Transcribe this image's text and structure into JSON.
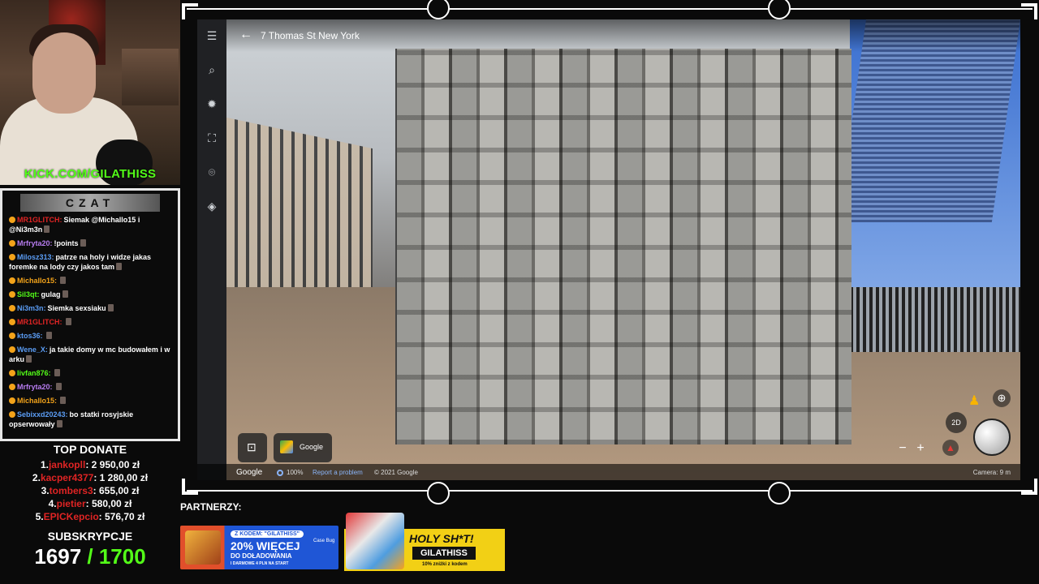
{
  "stream": {
    "kick_url": "KICK.COM/GILATHISS"
  },
  "chat": {
    "title": "CZAT",
    "messages": [
      {
        "user": "MR1GLITCH:",
        "user_color": "#e02424",
        "text": "Siemak @Michallo15 i @Ni3m3n"
      },
      {
        "user": "Mrfryta20:",
        "user_color": "#b77cf0",
        "text": "!points"
      },
      {
        "user": "Milosz313:",
        "user_color": "#5b9df5",
        "text": "patrze na holy i widze jakas foremke na lody czy jakos tam"
      },
      {
        "user": "Michallo15:",
        "user_color": "#f3a31a",
        "text": ""
      },
      {
        "user": "Sil3qt:",
        "user_color": "#53fc18",
        "text": "gulag"
      },
      {
        "user": "Ni3m3n:",
        "user_color": "#5b9df5",
        "text": "Siemka sexsiaku"
      },
      {
        "user": "MR1GLITCH:",
        "user_color": "#e02424",
        "text": ""
      },
      {
        "user": "ktos36:",
        "user_color": "#5b9df5",
        "text": ""
      },
      {
        "user": "Wene_X:",
        "user_color": "#5b9df5",
        "text": "ja takie domy w mc budowałem i w arku"
      },
      {
        "user": "livfan876:",
        "user_color": "#53fc18",
        "text": ""
      },
      {
        "user": "Mrfryta20:",
        "user_color": "#b77cf0",
        "text": ""
      },
      {
        "user": "Michallo15:",
        "user_color": "#f3a31a",
        "text": ""
      },
      {
        "user": "Sebixxd20243:",
        "user_color": "#5b9df5",
        "text": "bo statki rosyjskie opserwowały"
      }
    ]
  },
  "top_donate": {
    "title": "TOP DONATE",
    "entries": [
      {
        "rank": "1.",
        "name": "jankopll",
        "amount": "2 950,00 zł"
      },
      {
        "rank": "2.",
        "name": "kacper4377",
        "amount": "1 280,00 zł"
      },
      {
        "rank": "3.",
        "name": "tombers3",
        "amount": "655,00 zł"
      },
      {
        "rank": "4.",
        "name": "pietier",
        "amount": "580,00 zł"
      },
      {
        "rank": "5.",
        "name": "EPICKepcio",
        "amount": "576,70 zł"
      }
    ]
  },
  "subs": {
    "title": "SUBSKRYPCJE",
    "current": "1697",
    "goal": "/ 1700"
  },
  "maps": {
    "address": "7 Thomas St New York",
    "google_chip": "Google",
    "footer_google": "Google",
    "zoom": "100%",
    "report": "Report a problem",
    "copyright": "© 2021 Google",
    "camera": "Camera: 9 m",
    "btn_2d": "2D",
    "zoom_in": "+",
    "zoom_out": "−"
  },
  "partners": {
    "label": "PARTNERZY:",
    "banner1": {
      "code": "Z KODEM: \"GILATHISS\"",
      "percent": "20% WIĘCEJ",
      "line1": "DO DOŁADOWANIA",
      "line2": "I DARMOWE 4 PLN NA START",
      "brand": "Case Bug"
    },
    "banner2": {
      "headline": "HOLY SH*T!",
      "code": "GILATHISS",
      "sub": "10% zniżki z kodem"
    }
  }
}
